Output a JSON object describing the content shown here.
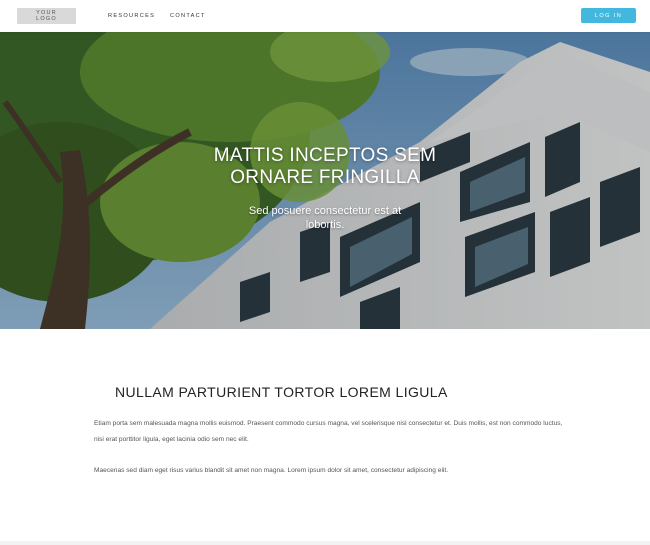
{
  "header": {
    "logo_line1": "YOUR",
    "logo_line2": "LOGO",
    "nav": [
      "RESOURCES",
      "CONTACT"
    ],
    "login_label": "LOG IN"
  },
  "hero": {
    "title_line1": "MATTIS INCEPTOS SEM",
    "title_line2": "ORNARE FRINGILLA",
    "subtitle_line1": "Sed posuere consectetur est at",
    "subtitle_line2": "lobortis."
  },
  "content": {
    "heading": "NULLAM PARTURIENT TORTOR LOREM LIGULA",
    "paragraph1": "Etiam porta sem malesuada magna mollis euismod. Praesent commodo cursus magna, vel scelerisque nisl consectetur et. Duis mollis, est non commodo luctus, nisi erat porttitor ligula, eget lacinia odio sem nec elit.",
    "paragraph2": "Maecenas sed diam eget risus varius blandit sit amet non magna. Lorem ipsum dolor sit amet, consectetur adipiscing elit."
  },
  "colors": {
    "accent": "#43b8de",
    "logo_bg": "#d9d9d9",
    "heading": "#222222",
    "body_text": "#555555"
  }
}
